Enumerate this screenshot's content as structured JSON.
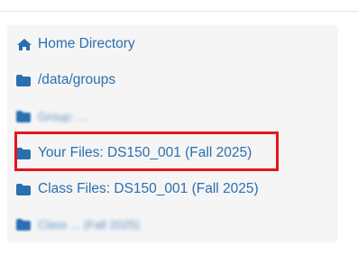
{
  "sidebar": {
    "items": [
      {
        "label": "Home Directory",
        "icon": "home-icon"
      },
      {
        "label": "/data/groups",
        "icon": "folder-icon"
      },
      {
        "label": "Group: ...",
        "icon": "folder-icon",
        "redacted": true
      },
      {
        "label": "Your Files: DS150_001 (Fall 2025)",
        "icon": "folder-icon",
        "highlighted": true
      },
      {
        "label": "Class Files: DS150_001 (Fall 2025)",
        "icon": "folder-icon"
      },
      {
        "label": "Class ... (Fall 2025)",
        "icon": "folder-icon",
        "redacted": true
      }
    ]
  },
  "colors": {
    "link": "#2a6fb0",
    "panel_bg": "#f5f5f5",
    "highlight": "#e4171c"
  }
}
